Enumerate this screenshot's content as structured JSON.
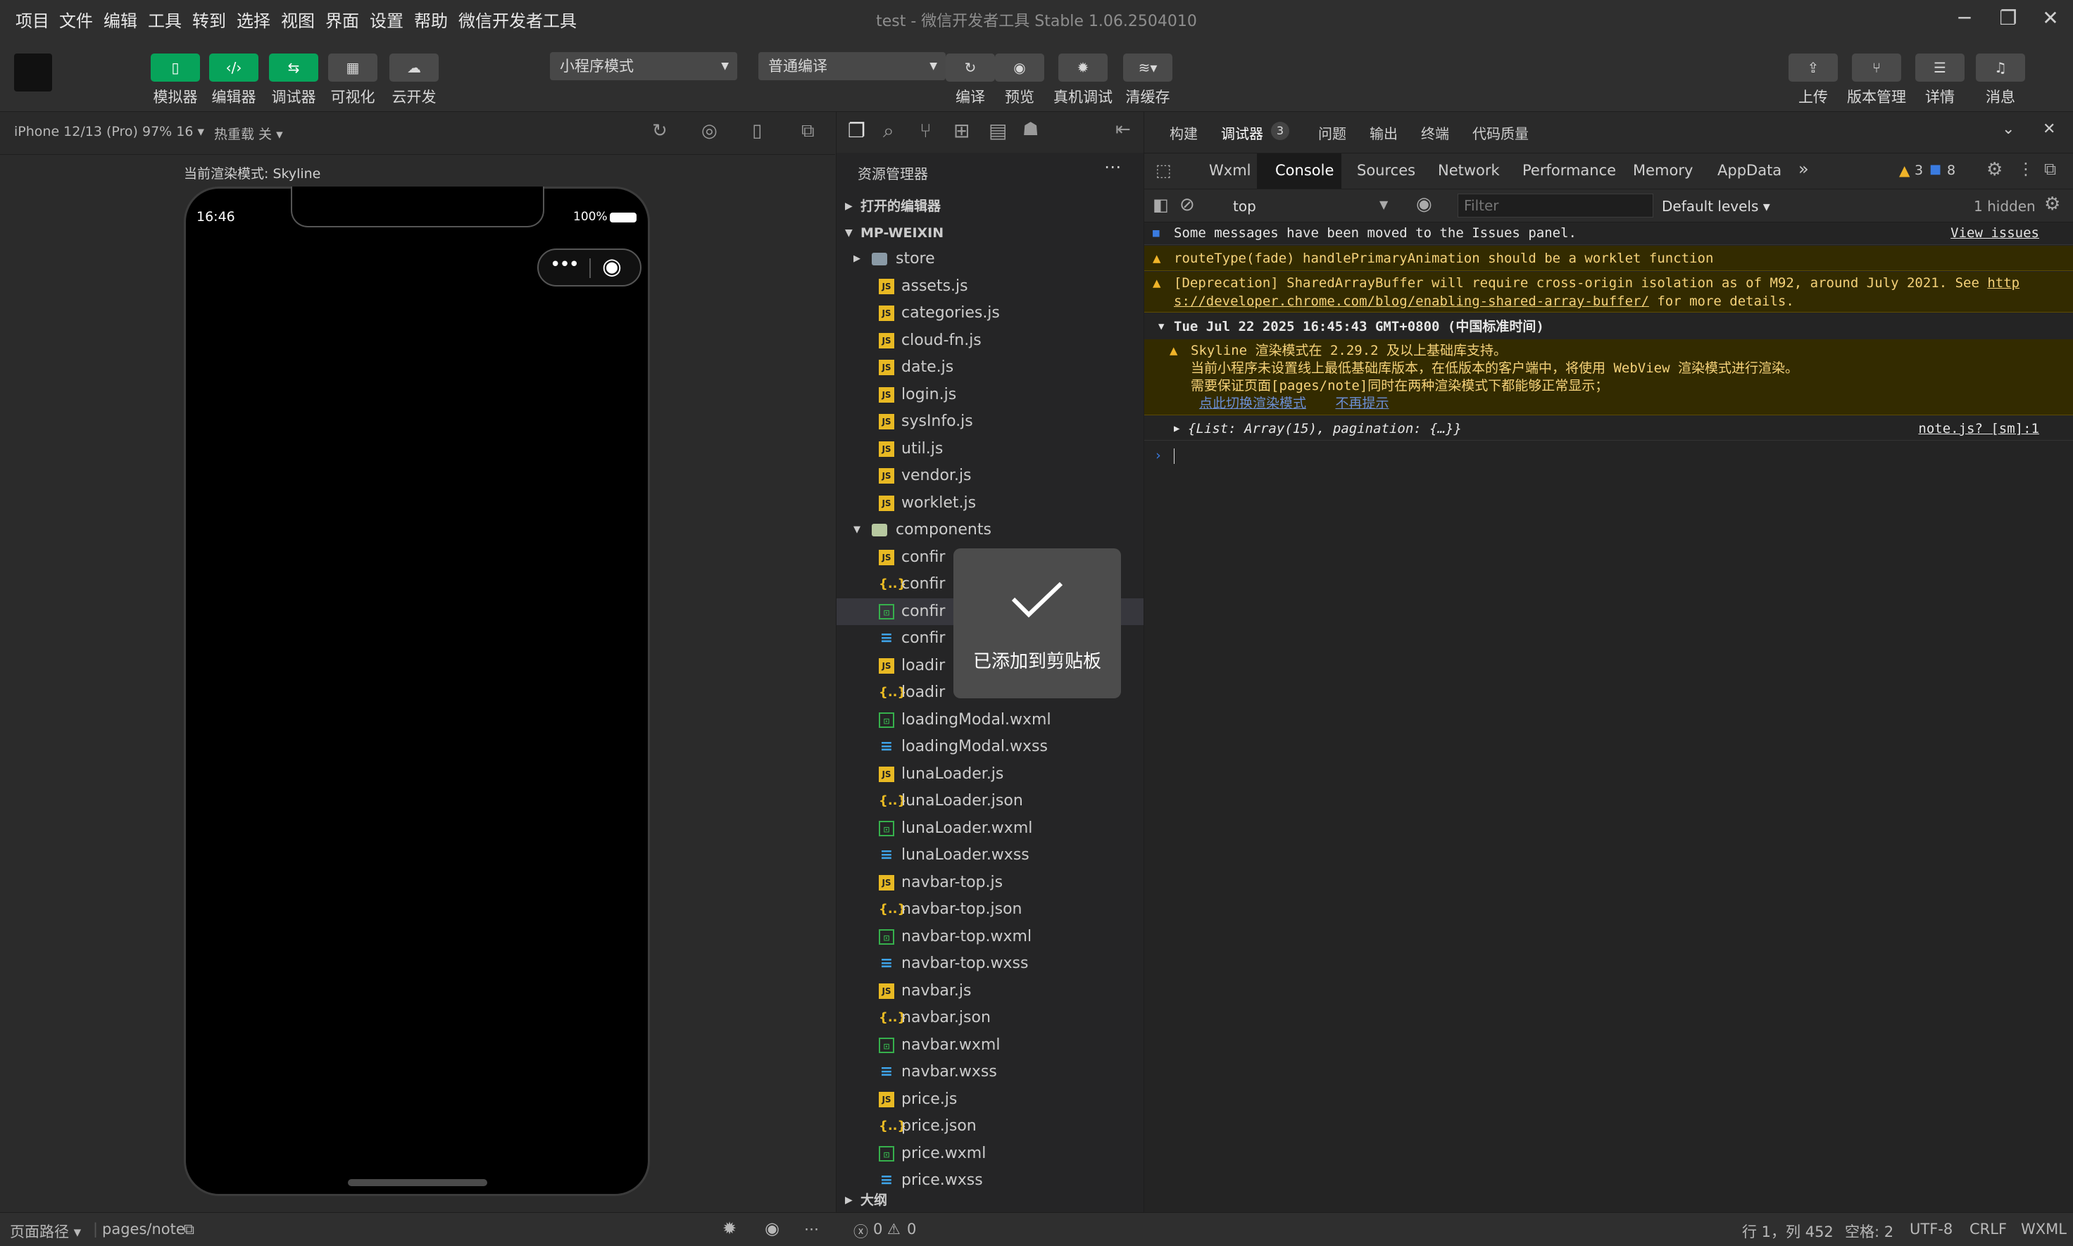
{
  "menubar": {
    "items": [
      "项目",
      "文件",
      "编辑",
      "工具",
      "转到",
      "选择",
      "视图",
      "界面",
      "设置",
      "帮助",
      "微信开发者工具"
    ],
    "title": "test - 微信开发者工具 Stable 1.06.2504010"
  },
  "toolbar": {
    "mode_buttons": [
      {
        "label": "模拟器",
        "icon": "phone-icon"
      },
      {
        "label": "编辑器",
        "icon": "code-icon"
      },
      {
        "label": "调试器",
        "icon": "debug-icon"
      },
      {
        "label": "可视化",
        "icon": "layout-icon"
      },
      {
        "label": "云开发",
        "icon": "cloud-icon"
      }
    ],
    "mode_select": "小程序模式",
    "compile_select": "普通编译",
    "actions": [
      "编译",
      "预览",
      "真机调试",
      "清缓存"
    ],
    "right_actions": [
      "上传",
      "版本管理",
      "详情",
      "消息"
    ]
  },
  "simulator": {
    "device": "iPhone 12/13 (Pro) 97% 16",
    "hot_reload": "热重载 关",
    "render_mode": "当前渲染模式: Skyline",
    "time": "16:46",
    "battery": "100%"
  },
  "explorer": {
    "title": "资源管理器",
    "open_editors": "打开的编辑器",
    "root": "MP-WEIXIN",
    "outline": "大纲",
    "rows": [
      {
        "name": "store",
        "type": "folder",
        "indent": 1
      },
      {
        "name": "assets.js",
        "type": "js",
        "indent": 2
      },
      {
        "name": "categories.js",
        "type": "js",
        "indent": 2
      },
      {
        "name": "cloud-fn.js",
        "type": "js",
        "indent": 2
      },
      {
        "name": "date.js",
        "type": "js",
        "indent": 2
      },
      {
        "name": "login.js",
        "type": "js",
        "indent": 2
      },
      {
        "name": "sysInfo.js",
        "type": "js",
        "indent": 2
      },
      {
        "name": "util.js",
        "type": "js",
        "indent": 2
      },
      {
        "name": "vendor.js",
        "type": "js",
        "indent": 2
      },
      {
        "name": "worklet.js",
        "type": "js",
        "indent": 2
      },
      {
        "name": "components",
        "type": "openfolder",
        "indent": 1
      },
      {
        "name": "confir",
        "type": "js",
        "indent": 2
      },
      {
        "name": "confir",
        "type": "json",
        "indent": 2
      },
      {
        "name": "confir",
        "type": "wxml",
        "indent": 2
      },
      {
        "name": "confir",
        "type": "wxss",
        "indent": 2
      },
      {
        "name": "loadir",
        "type": "js",
        "indent": 2
      },
      {
        "name": "loadir",
        "type": "json",
        "indent": 2
      },
      {
        "name": "loadingModal.wxml",
        "type": "wxml",
        "indent": 2
      },
      {
        "name": "loadingModal.wxss",
        "type": "wxss",
        "indent": 2
      },
      {
        "name": "lunaLoader.js",
        "type": "js",
        "indent": 2
      },
      {
        "name": "lunaLoader.json",
        "type": "json",
        "indent": 2
      },
      {
        "name": "lunaLoader.wxml",
        "type": "wxml",
        "indent": 2
      },
      {
        "name": "lunaLoader.wxss",
        "type": "wxss",
        "indent": 2
      },
      {
        "name": "navbar-top.js",
        "type": "js",
        "indent": 2
      },
      {
        "name": "navbar-top.json",
        "type": "json",
        "indent": 2
      },
      {
        "name": "navbar-top.wxml",
        "type": "wxml",
        "indent": 2
      },
      {
        "name": "navbar-top.wxss",
        "type": "wxss",
        "indent": 2
      },
      {
        "name": "navbar.js",
        "type": "js",
        "indent": 2
      },
      {
        "name": "navbar.json",
        "type": "json",
        "indent": 2
      },
      {
        "name": "navbar.wxml",
        "type": "wxml",
        "indent": 2
      },
      {
        "name": "navbar.wxss",
        "type": "wxss",
        "indent": 2
      },
      {
        "name": "price.js",
        "type": "js",
        "indent": 2
      },
      {
        "name": "price.json",
        "type": "json",
        "indent": 2
      },
      {
        "name": "price.wxml",
        "type": "wxml",
        "indent": 2
      },
      {
        "name": "price.wxss",
        "type": "wxss",
        "indent": 2
      }
    ]
  },
  "devtools": {
    "panel_tabs": [
      "构建",
      "调试器",
      "问题",
      "输出",
      "终端",
      "代码质量"
    ],
    "debugger_badge": "3",
    "tabs": [
      "Wxml",
      "Console",
      "Sources",
      "Network",
      "Performance",
      "Memory",
      "AppData"
    ],
    "warn_count": "3",
    "info_count": "8",
    "context": "top",
    "filter_placeholder": "Filter",
    "levels": "Default levels",
    "hidden": "1 hidden",
    "console": {
      "issues_msg": "Some messages have been moved to the Issues panel.",
      "issues_link": "View issues",
      "warn1": "routeType(fade) handlePrimaryAnimation should be a worklet function",
      "warn2_a": "[Deprecation] SharedArrayBuffer will require cross-origin isolation as of M92, around July 2021. See ",
      "warn2_link_a": "http",
      "warn2_link_b": "s://developer.chrome.com/blog/enabling-shared-array-buffer/",
      "warn2_b": " for more details.",
      "group": "Tue Jul 22 2025 16:45:43 GMT+0800 (中国标准时间)",
      "sky1": "Skyline 渲染模式在 2.29.2 及以上基础库支持。",
      "sky2": "当前小程序未设置线上最低基础库版本，在低版本的客户端中，将使用 WebView 渲染模式进行渲染。",
      "sky3": "需要保证页面[pages/note]同时在两种渲染模式下都能够正常显示；",
      "sky_link1": "点此切换渲染模式",
      "sky_link2": "不再提示",
      "obj": "{List: Array(15), pagination: {…}}",
      "obj_src": "note.js? [sm]:1"
    }
  },
  "toast": {
    "text": "已添加到剪贴板"
  },
  "statusbar": {
    "page_path_label": "页面路径",
    "page_path": "pages/note",
    "errors": "0",
    "warnings": "0",
    "cursor": "行 1，列 452",
    "spaces": "空格: 2",
    "encoding": "UTF-8",
    "eol": "CRLF",
    "lang": "WXML"
  }
}
